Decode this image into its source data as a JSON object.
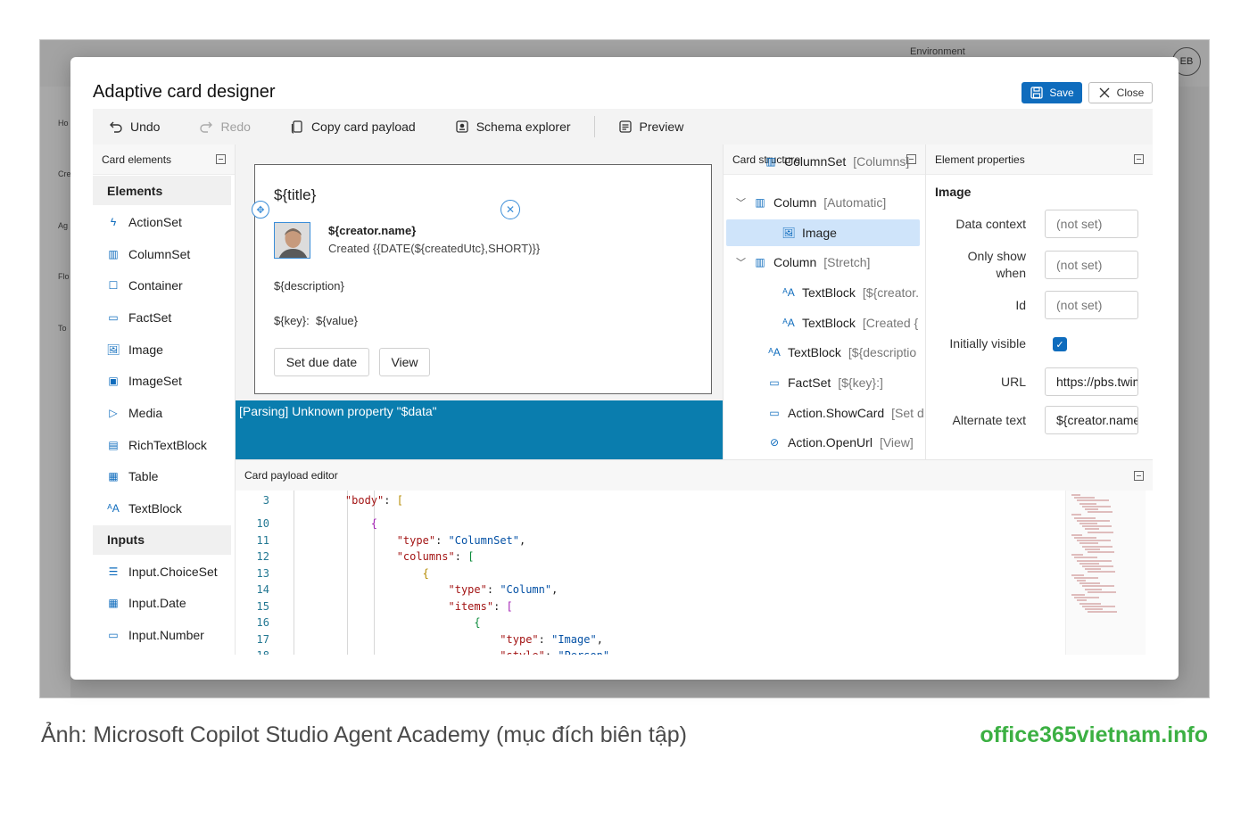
{
  "background": {
    "environment_label": "Environment",
    "avatar_initials": "EB",
    "nav": [
      "Ho",
      "Cre",
      "Ag",
      "Flo",
      "To"
    ]
  },
  "modal": {
    "title": "Adaptive card designer",
    "save_label": "Save",
    "close_label": "Close"
  },
  "toolbar": {
    "undo": "Undo",
    "redo": "Redo",
    "copy": "Copy card payload",
    "schema": "Schema explorer",
    "preview": "Preview"
  },
  "card_elements": {
    "header": "Card elements",
    "groups": [
      {
        "title": "Elements",
        "items": [
          {
            "label": "ActionSet",
            "icon": "lightning-icon"
          },
          {
            "label": "ColumnSet",
            "icon": "columns-icon"
          },
          {
            "label": "Container",
            "icon": "square-icon"
          },
          {
            "label": "FactSet",
            "icon": "factset-icon"
          },
          {
            "label": "Image",
            "icon": "image-icon"
          },
          {
            "label": "ImageSet",
            "icon": "imageset-icon"
          },
          {
            "label": "Media",
            "icon": "play-icon"
          },
          {
            "label": "RichTextBlock",
            "icon": "richtext-icon"
          },
          {
            "label": "Table",
            "icon": "table-icon"
          },
          {
            "label": "TextBlock",
            "icon": "text-icon"
          }
        ]
      },
      {
        "title": "Inputs",
        "items": [
          {
            "label": "Input.ChoiceSet",
            "icon": "list-icon"
          },
          {
            "label": "Input.Date",
            "icon": "calendar-icon"
          },
          {
            "label": "Input.Number",
            "icon": "number-icon"
          }
        ]
      }
    ]
  },
  "card_preview": {
    "title": "${title}",
    "creator_name": "${creator.name}",
    "created": "Created {{DATE(${createdUtc},SHORT)}}",
    "description": "${description}",
    "fact_key": "${key}:",
    "fact_value": "${value}",
    "button_due": "Set due date",
    "button_view": "View",
    "error": "[Parsing] Unknown property \"$data\""
  },
  "card_structure": {
    "header": "Card structure",
    "items": [
      {
        "label": "ColumnSet",
        "sub": "[Columns]"
      },
      {
        "label": "Column",
        "sub": "[Automatic]"
      },
      {
        "label": "Image",
        "sub": ""
      },
      {
        "label": "Column",
        "sub": "[Stretch]"
      },
      {
        "label": "TextBlock",
        "sub": "[${creator."
      },
      {
        "label": "TextBlock",
        "sub": "[Created {"
      },
      {
        "label": "TextBlock",
        "sub": "[${descriptio"
      },
      {
        "label": "FactSet",
        "sub": "[${key}:]"
      },
      {
        "label": "Action.ShowCard",
        "sub": "[Set d"
      },
      {
        "label": "Action.OpenUrl",
        "sub": "[View]"
      }
    ]
  },
  "element_properties": {
    "header": "Element properties",
    "section": "Image",
    "data_context_label": "Data context",
    "data_context_value": "(not set)",
    "only_show_label": "Only show when",
    "only_show_value": "(not set)",
    "id_label": "Id",
    "id_value": "(not set)",
    "visible_label": "Initially visible",
    "url_label": "URL",
    "url_value": "https://pbs.twimg",
    "alt_label": "Alternate text",
    "alt_value": "${creator.name}"
  },
  "editor": {
    "header": "Card payload editor",
    "lines": [
      {
        "n": "3",
        "indent": 1,
        "parts": [
          [
            "key",
            "\"body\""
          ],
          [
            "pun",
            ": "
          ],
          [
            "br1",
            "["
          ]
        ]
      },
      {
        "n": "10",
        "indent": 2,
        "parts": [
          [
            "br2",
            "{"
          ]
        ]
      },
      {
        "n": "11",
        "indent": 3,
        "parts": [
          [
            "key",
            "\"type\""
          ],
          [
            "pun",
            ": "
          ],
          [
            "str",
            "\"ColumnSet\""
          ],
          [
            "pun",
            ","
          ]
        ]
      },
      {
        "n": "12",
        "indent": 3,
        "parts": [
          [
            "key",
            "\"columns\""
          ],
          [
            "pun",
            ": "
          ],
          [
            "br3",
            "["
          ]
        ]
      },
      {
        "n": "13",
        "indent": 4,
        "parts": [
          [
            "br1",
            "{"
          ]
        ]
      },
      {
        "n": "14",
        "indent": 5,
        "parts": [
          [
            "key",
            "\"type\""
          ],
          [
            "pun",
            ": "
          ],
          [
            "str",
            "\"Column\""
          ],
          [
            "pun",
            ","
          ]
        ]
      },
      {
        "n": "15",
        "indent": 5,
        "parts": [
          [
            "key",
            "\"items\""
          ],
          [
            "pun",
            ": "
          ],
          [
            "br2",
            "["
          ]
        ]
      },
      {
        "n": "16",
        "indent": 6,
        "parts": [
          [
            "br3",
            "{"
          ]
        ]
      },
      {
        "n": "17",
        "indent": 7,
        "parts": [
          [
            "key",
            "\"type\""
          ],
          [
            "pun",
            ": "
          ],
          [
            "str",
            "\"Image\""
          ],
          [
            "pun",
            ","
          ]
        ]
      },
      {
        "n": "18",
        "indent": 7,
        "parts": [
          [
            "key",
            "\"style\""
          ],
          [
            "pun",
            ": "
          ],
          [
            "str",
            "\"Person\""
          ],
          [
            "pun",
            ","
          ]
        ]
      }
    ]
  },
  "caption": "Ảnh: Microsoft Copilot Studio Agent Academy (mục đích biên tập)",
  "site": "office365vietnam.info",
  "colors": {
    "accent": "#0f6cbd",
    "error_bar": "#0a7dae",
    "selected": "#cfe4fa",
    "site": "#3cb043"
  }
}
